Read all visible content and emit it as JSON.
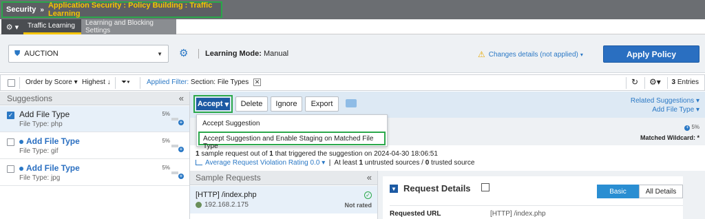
{
  "breadcrumb": {
    "root": "Security",
    "separator": "»",
    "path": "Application Security : Policy Building : Traffic Learning"
  },
  "tabs": [
    {
      "label": "Traffic Learning",
      "active": true
    },
    {
      "label": "Learning and Blocking Settings",
      "active": false
    }
  ],
  "policy": {
    "selected": "AUCTION",
    "learning_mode_label": "Learning Mode:",
    "learning_mode_value": "Manual",
    "changes_text": "Changes details (not applied)",
    "apply_label": "Apply Policy"
  },
  "toolbar": {
    "order_by": "Order by Score",
    "sort": "Highest",
    "applied_filter_label": "Applied Filter:",
    "applied_filter_value": "Section: File Types",
    "entries_count": "3",
    "entries_label": "Entries"
  },
  "suggestions": {
    "header": "Suggestions",
    "items": [
      {
        "title": "Add File Type",
        "subtitle": "File Type: php",
        "score": "5%",
        "selected": true,
        "unread": false
      },
      {
        "title": "Add File Type",
        "subtitle": "File Type: gif",
        "score": "5%",
        "selected": false,
        "unread": true
      },
      {
        "title": "Add File Type",
        "subtitle": "File Type: jpg",
        "score": "5%",
        "selected": false,
        "unread": true
      }
    ]
  },
  "actions": {
    "accept": "Accept",
    "delete": "Delete",
    "ignore": "Ignore",
    "export": "Export",
    "related": "Related Suggestions",
    "add_file_type": "Add File Type"
  },
  "accept_menu": {
    "items": [
      "Accept Suggestion",
      "Accept Suggestion and Enable Staging on Matched File Type"
    ]
  },
  "details_info": {
    "wildcard_pct": "5%",
    "wildcard_label": "Matched Wildcard:",
    "wildcard_value": "*",
    "request_count": "1",
    "request_total": "1",
    "request_date": "2024-04-30 18:06:51",
    "rating_text": "Average Request Violation Rating 0.0",
    "untrusted_count": "1",
    "trusted_count": "0"
  },
  "sample_requests": {
    "header": "Sample Requests",
    "items": [
      {
        "url": "[HTTP] /index.php",
        "ip": "192.168.2.175",
        "status": "Not rated"
      }
    ]
  },
  "request_details": {
    "title": "Request Details",
    "view_basic": "Basic",
    "view_all": "All Details",
    "rows": [
      {
        "label": "Requested URL",
        "value": "[HTTP] /index.php"
      }
    ]
  },
  "colors": {
    "accent": "#2a78c5",
    "highlight": "#2aa84a",
    "breadcrumb_path": "#f5c400"
  }
}
